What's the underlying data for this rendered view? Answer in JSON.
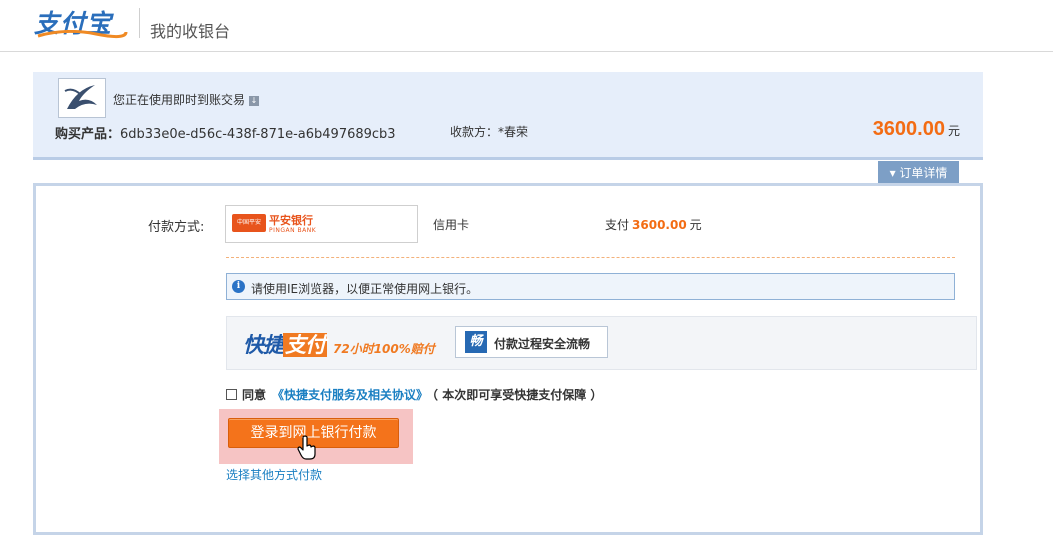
{
  "header": {
    "logo_text": "支付宝",
    "title": "我的收银台"
  },
  "summary": {
    "trade_type": "您正在使用即时到账交易",
    "product_label": "购买产品：",
    "product_id": "6db33e0e-d56c-438f-871e-a6b497689cb3",
    "payee_label": "收款方：",
    "payee": "*春荣",
    "amount": "3600.00",
    "currency_unit": "元",
    "detail_tab": "订单详情"
  },
  "payment": {
    "method_label": "付款方式:",
    "bank_name": "平安银行",
    "bank_name_en": "PINGAN BANK",
    "bank_logo_text": "中国平安",
    "card_type": "信用卡",
    "pay_label": "支付",
    "pay_amount": "3600.00",
    "pay_unit": "元",
    "notice": "请使用IE浏览器，以便正常使用网上银行。"
  },
  "express": {
    "title_a": "快捷",
    "title_b": "支付",
    "subtitle": "72小时100%赔付",
    "badge_icon": "畅",
    "badge_text": "付款过程安全流畅"
  },
  "agreement": {
    "checked": false,
    "agree_text": "同意",
    "link_text": "《快捷支付服务及相关协议》",
    "note": "（ 本次即可享受快捷支付保障 ）"
  },
  "actions": {
    "login_button": "登录到网上银行付款",
    "other_methods": "选择其他方式付款"
  },
  "colors": {
    "brand_blue": "#2a6ebb",
    "accent_orange": "#f36c13",
    "link_blue": "#1a7fc2"
  }
}
